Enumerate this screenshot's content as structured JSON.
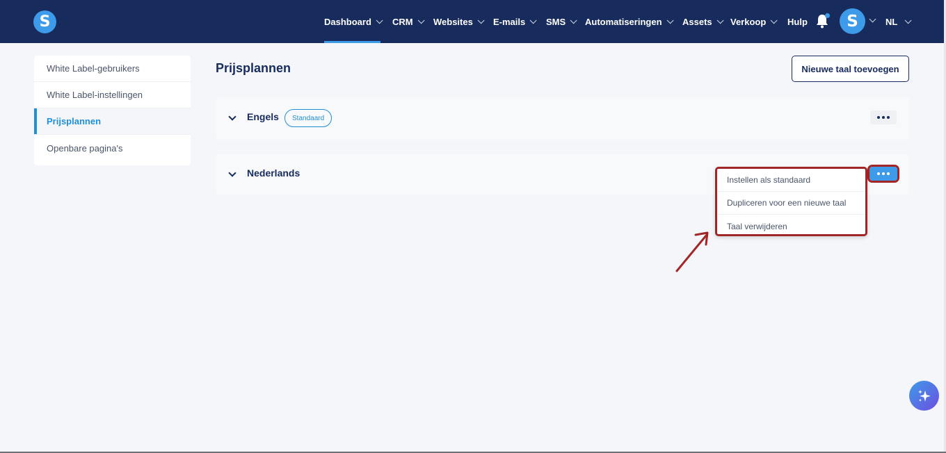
{
  "brand": {
    "logo_letter": "S"
  },
  "nav": {
    "items": [
      {
        "label": "Dashboard",
        "active": true,
        "has_dropdown": true
      },
      {
        "label": "CRM",
        "active": false,
        "has_dropdown": true
      },
      {
        "label": "Websites",
        "active": false,
        "has_dropdown": true
      },
      {
        "label": "E-mails",
        "active": false,
        "has_dropdown": true
      },
      {
        "label": "SMS",
        "active": false,
        "has_dropdown": true
      },
      {
        "label": "Automatiseringen",
        "active": false,
        "has_dropdown": true
      },
      {
        "label": "Assets",
        "active": false,
        "has_dropdown": true
      },
      {
        "label": "Verkoop",
        "active": false,
        "has_dropdown": true
      },
      {
        "label": "Hulp",
        "active": false,
        "has_dropdown": false
      }
    ],
    "notification_icon": "bell-icon",
    "avatar_letter": "S",
    "language": "NL"
  },
  "sidebar": {
    "items": [
      {
        "label": "White Label-gebruikers",
        "active": false
      },
      {
        "label": "White Label-instellingen",
        "active": false
      },
      {
        "label": "Prijsplannen",
        "active": true
      },
      {
        "label": "Openbare pagina's",
        "active": false
      }
    ]
  },
  "main": {
    "title": "Prijsplannen",
    "add_button_label": "Nieuwe taal toevoegen",
    "languages": [
      {
        "name": "Engels",
        "badge": "Standaard"
      },
      {
        "name": "Nederlands",
        "badge": ""
      }
    ],
    "dropdown_menu": [
      "Instellen als standaard",
      "Dupliceren voor een nieuwe taal",
      "Taal verwijderen"
    ]
  },
  "colors": {
    "nav_bg": "#172b5c",
    "accent": "#3d9be9",
    "highlight": "#a32626",
    "page_bg": "#f4f6fa"
  }
}
